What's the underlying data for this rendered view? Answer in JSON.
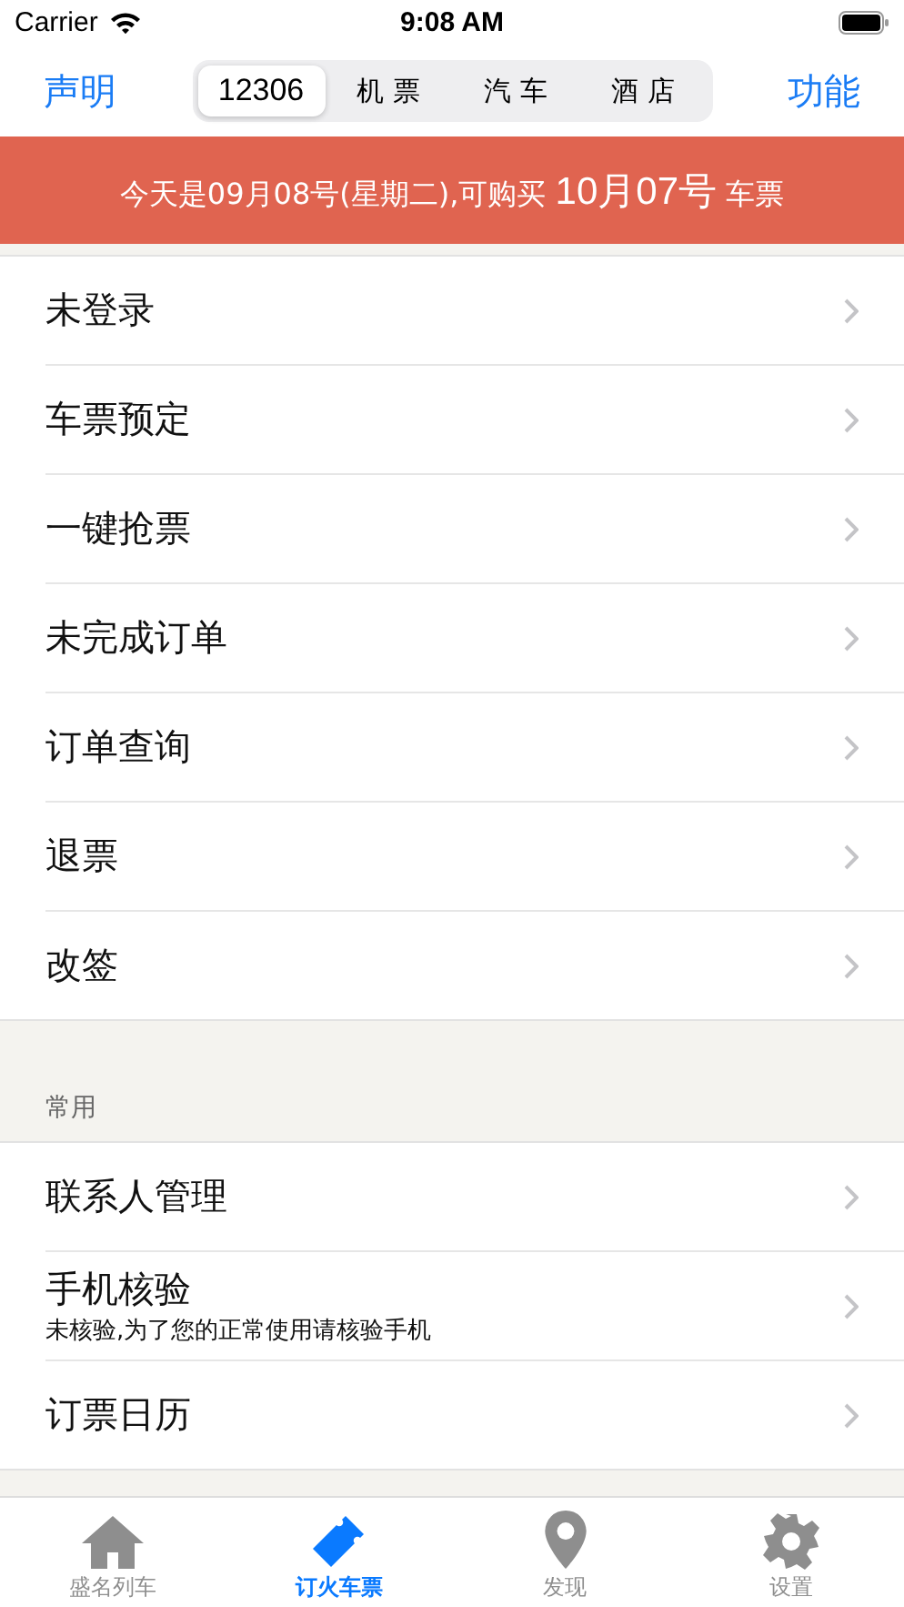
{
  "status_bar": {
    "carrier": "Carrier",
    "time": "9:08 AM"
  },
  "nav": {
    "left": "声明",
    "right": "功能",
    "segments": [
      {
        "label": "12306",
        "selected": true
      },
      {
        "label": "机 票",
        "selected": false
      },
      {
        "label": "汽 车",
        "selected": false
      },
      {
        "label": "酒 店",
        "selected": false
      }
    ]
  },
  "banner": "今天是09月08号(星期二),可购买 **10月07号** 车票",
  "sections": [
    {
      "items": [
        {
          "title": "未登录"
        },
        {
          "title": "车票预定"
        },
        {
          "title": "一键抢票"
        },
        {
          "title": "未完成订单"
        },
        {
          "title": "订单查询"
        },
        {
          "title": "退票"
        },
        {
          "title": "改签"
        }
      ]
    },
    {
      "header": "常用",
      "items": [
        {
          "title": "联系人管理"
        },
        {
          "title": "手机核验",
          "subtitle": "未核验,为了您的正常使用请核验手机"
        },
        {
          "title": "订票日历"
        }
      ]
    }
  ],
  "tab_bar": [
    {
      "label": "盛名列车",
      "selected": false
    },
    {
      "label": "订火车票",
      "selected": true
    },
    {
      "label": "发现",
      "selected": false
    },
    {
      "label": "设置",
      "selected": false
    }
  ]
}
